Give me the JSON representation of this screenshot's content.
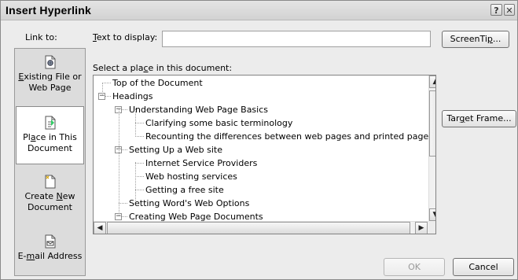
{
  "dialog": {
    "title": "Insert Hyperlink",
    "help_button": "?",
    "close_button": "✕"
  },
  "link_to": {
    "label": "Link to:",
    "items": [
      {
        "label_pre": "",
        "label_key": "",
        "label_post": "Existing File or Web Page",
        "accel": "E",
        "icon": "document-web-icon",
        "active": false
      },
      {
        "label": "Place in This Document",
        "accel": "a",
        "icon": "place-in-document-icon",
        "active": true
      },
      {
        "label": "Create New Document",
        "accel": "N",
        "icon": "new-document-icon",
        "active": false
      },
      {
        "label": "E-mail Address",
        "accel": "m",
        "icon": "email-document-icon",
        "active": false
      }
    ]
  },
  "text_to_display": {
    "label_accel": "T",
    "label_rest": "ext to display:",
    "value": ""
  },
  "screentip_button": {
    "label_pre": "ScreenTi",
    "accel": "p",
    "label_post": "..."
  },
  "select_place": {
    "label_pre": "Select a pla",
    "accel": "c",
    "label_post": "e in this document:"
  },
  "tree": [
    {
      "text": "Top of the Document",
      "level": 0,
      "expander": ""
    },
    {
      "text": "Headings",
      "level": 0,
      "expander": "−"
    },
    {
      "text": "Understanding Web Page Basics",
      "level": 1,
      "expander": "−"
    },
    {
      "text": "Clarifying some basic terminology",
      "level": 2,
      "expander": ""
    },
    {
      "text": "Recounting the differences between web pages and printed page",
      "level": 2,
      "expander": ""
    },
    {
      "text": "Setting Up a Web site",
      "level": 1,
      "expander": "−"
    },
    {
      "text": "Internet Service Providers",
      "level": 2,
      "expander": ""
    },
    {
      "text": "Web hosting services",
      "level": 2,
      "expander": ""
    },
    {
      "text": "Getting a free site",
      "level": 2,
      "expander": ""
    },
    {
      "text": "Setting Word's Web Options",
      "level": 1,
      "expander": ""
    },
    {
      "text": "Creating Web Page Documents",
      "level": 1,
      "expander": "−"
    }
  ],
  "target_frame_button": {
    "label_pre": "Tar",
    "accel": "g",
    "label_post": "et Frame..."
  },
  "ok_button": "OK",
  "cancel_button": "Cancel",
  "scroll": {
    "up": "▲",
    "down": "▼",
    "left": "◀",
    "right": "▶"
  }
}
